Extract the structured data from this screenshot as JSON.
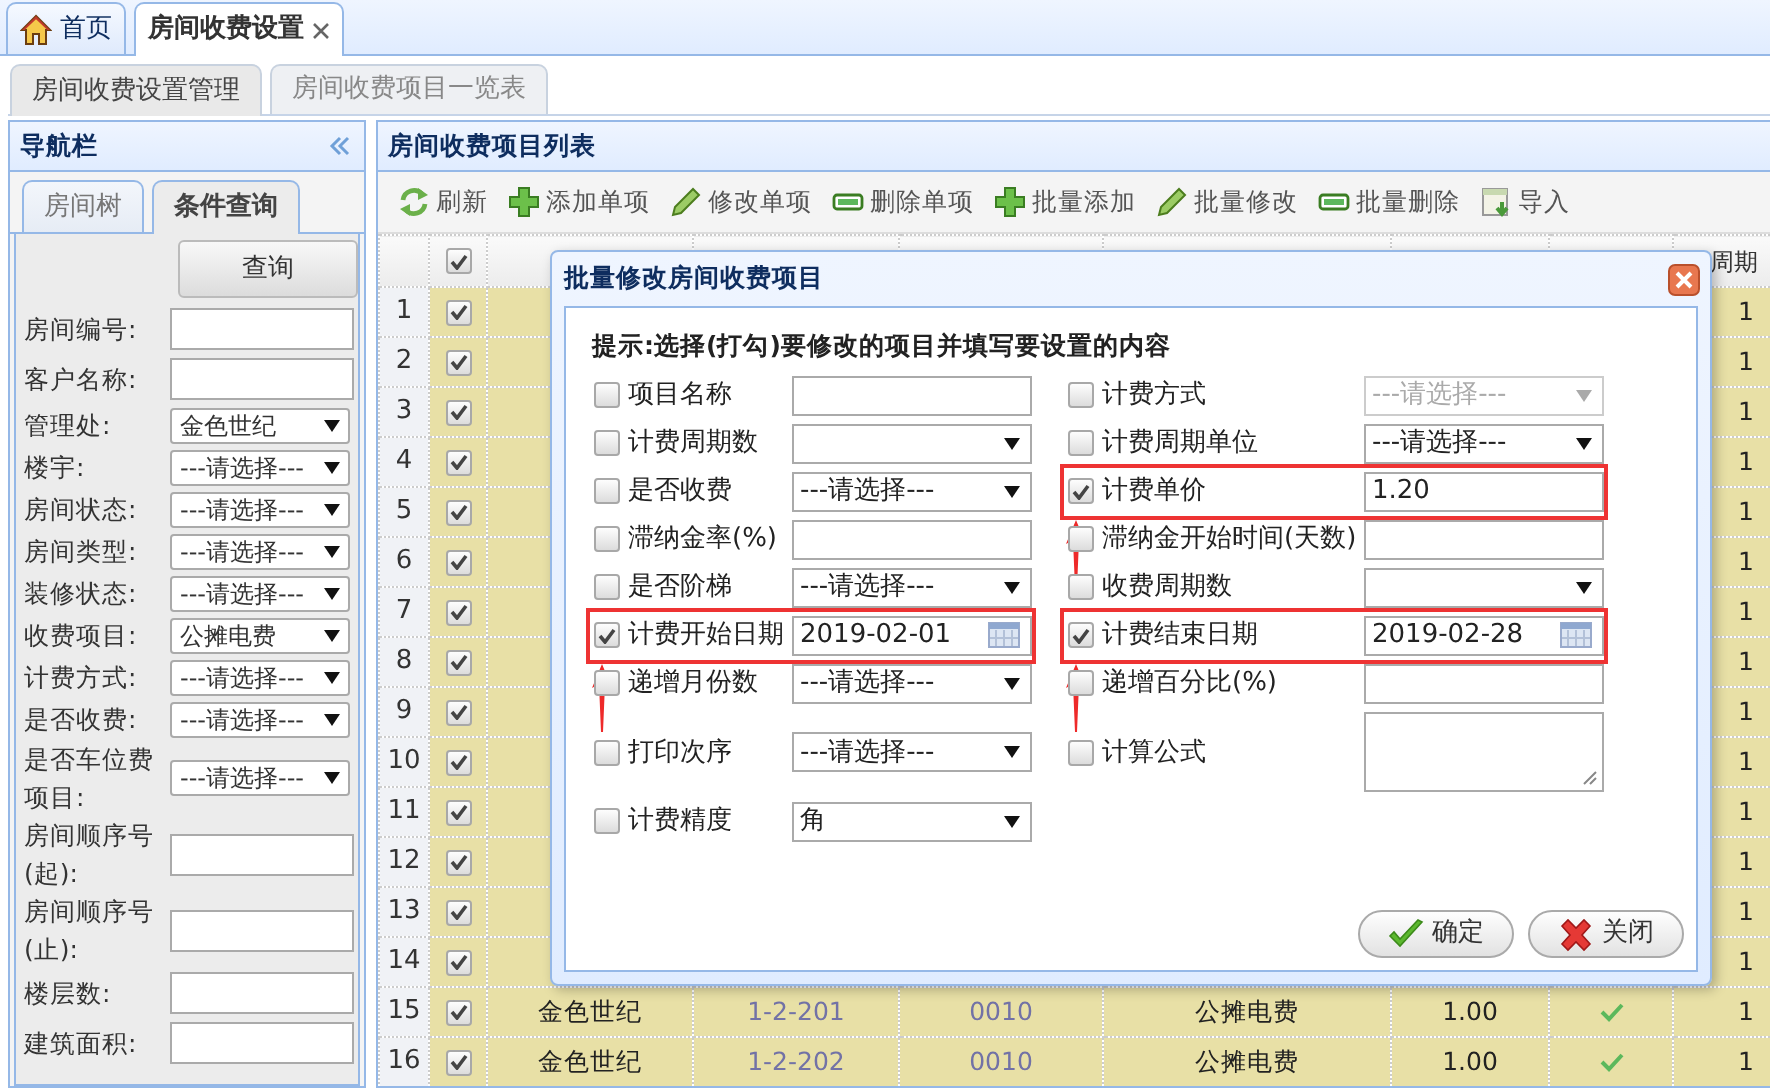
{
  "top_tabs": [
    {
      "label": "首页",
      "kind": "home",
      "selected": false,
      "closable": false
    },
    {
      "label": "房间收费设置",
      "kind": "plain",
      "selected": true,
      "closable": true
    }
  ],
  "sub_tabs": [
    {
      "label": "房间收费设置管理",
      "selected": true
    },
    {
      "label": "房间收费项目一览表",
      "selected": false
    }
  ],
  "sidebar": {
    "title": "导航栏",
    "tabs": [
      {
        "label": "房间树",
        "selected": false
      },
      {
        "label": "条件查询",
        "selected": true
      }
    ],
    "query_button": "查询",
    "fields": [
      {
        "label": "房间编号:",
        "kind": "text"
      },
      {
        "label": "客户名称:",
        "kind": "text"
      },
      {
        "label": "管理处:",
        "kind": "select",
        "value": "金色世纪"
      },
      {
        "label": "楼宇:",
        "kind": "select",
        "value": "---请选择---"
      },
      {
        "label": "房间状态:",
        "kind": "select",
        "value": "---请选择---"
      },
      {
        "label": "房间类型:",
        "kind": "select",
        "value": "---请选择---"
      },
      {
        "label": "装修状态:",
        "kind": "select",
        "value": "---请选择---"
      },
      {
        "label": "收费项目:",
        "kind": "select",
        "value": "公摊电费"
      },
      {
        "label": "计费方式:",
        "kind": "select",
        "value": "---请选择---"
      },
      {
        "label": "是否收费:",
        "kind": "select",
        "value": "---请选择---"
      },
      {
        "label": "是否车位费项目:",
        "kind": "select",
        "value": "---请选择---"
      },
      {
        "label": "房间顺序号(起):",
        "kind": "text"
      },
      {
        "label": "房间顺序号(止):",
        "kind": "text"
      },
      {
        "label": "楼层数:",
        "kind": "text"
      },
      {
        "label": "建筑面积:",
        "kind": "text"
      }
    ]
  },
  "list_panel": {
    "title": "房间收费项目列表",
    "toolbar": [
      {
        "label": "刷新",
        "kind": "refresh"
      },
      {
        "label": "添加单项",
        "kind": "add"
      },
      {
        "label": "修改单项",
        "kind": "edit"
      },
      {
        "label": "删除单项",
        "kind": "remove"
      },
      {
        "label": "批量添加",
        "kind": "add"
      },
      {
        "label": "批量修改",
        "kind": "edit"
      },
      {
        "label": "批量删除",
        "kind": "remove"
      },
      {
        "label": "导入",
        "kind": "import"
      }
    ],
    "table": {
      "all_checked": true,
      "last_column_heading": "周期",
      "rows": [
        {
          "number": "1",
          "checked": true,
          "period": "1"
        },
        {
          "number": "2",
          "checked": true,
          "period": "1"
        },
        {
          "number": "3",
          "checked": true,
          "period": "1"
        },
        {
          "number": "4",
          "checked": true,
          "period": "1"
        },
        {
          "number": "5",
          "checked": true,
          "period": "1"
        },
        {
          "number": "6",
          "checked": true,
          "period": "1"
        },
        {
          "number": "7",
          "checked": true,
          "period": "1"
        },
        {
          "number": "8",
          "checked": true,
          "period": "1"
        },
        {
          "number": "9",
          "checked": true,
          "period": "1"
        },
        {
          "number": "10",
          "checked": true,
          "period": "1"
        },
        {
          "number": "11",
          "checked": true,
          "period": "1"
        },
        {
          "number": "12",
          "checked": true,
          "period": "1"
        },
        {
          "number": "13",
          "checked": true,
          "period": "1"
        },
        {
          "number": "14",
          "checked": true,
          "period": "1"
        },
        {
          "number": "15",
          "checked": true,
          "manager": "金色世纪",
          "room": "1-2-201",
          "code": "0010",
          "item": "公摊电费",
          "amount": "1.00",
          "charged": true,
          "period": "1"
        },
        {
          "number": "16",
          "checked": true,
          "manager": "金色世纪",
          "room": "1-2-202",
          "code": "0010",
          "item": "公摊电费",
          "amount": "1.00",
          "charged": true,
          "period": "1"
        }
      ]
    }
  },
  "dialog": {
    "title": "批量修改房间收费项目",
    "hint": "提示:选择(打勾)要修改的项目并填写要设置的内容",
    "left_fields": [
      {
        "label": "项目名称",
        "kind": "text",
        "checked": false,
        "highlighted": false,
        "disabled": false
      },
      {
        "label": "计费周期数",
        "kind": "select",
        "checked": false,
        "highlighted": false,
        "disabled": false
      },
      {
        "label": "是否收费",
        "kind": "select",
        "value": "---请选择---",
        "checked": false,
        "highlighted": false,
        "disabled": false
      },
      {
        "label": "滞纳金率(%)",
        "kind": "text",
        "checked": false,
        "highlighted": false,
        "disabled": false
      },
      {
        "label": "是否阶梯",
        "kind": "select",
        "value": "---请选择---",
        "checked": false,
        "highlighted": false,
        "disabled": false
      },
      {
        "label": "计费开始日期",
        "kind": "date",
        "value": "2019-02-01",
        "checked": true,
        "highlighted": true,
        "disabled": false
      },
      {
        "label": "递增月份数",
        "kind": "select",
        "value": "---请选择---",
        "checked": false,
        "highlighted": false,
        "disabled": false
      },
      {
        "label": "打印次序",
        "kind": "select",
        "value": "---请选择---",
        "checked": false,
        "highlighted": false,
        "disabled": false
      },
      {
        "label": "计费精度",
        "kind": "select",
        "value": "角",
        "checked": false,
        "highlighted": false,
        "disabled": false
      }
    ],
    "right_fields": [
      {
        "label": "计费方式",
        "kind": "select",
        "value": "---请选择---",
        "checked": false,
        "highlighted": false,
        "disabled": true
      },
      {
        "label": "计费周期单位",
        "kind": "select",
        "value": "---请选择---",
        "checked": false,
        "highlighted": false,
        "disabled": false
      },
      {
        "label": "计费单价",
        "kind": "text",
        "value": "1.20",
        "checked": true,
        "highlighted": true,
        "disabled": false
      },
      {
        "label": "滞纳金开始时间(天数)",
        "kind": "text",
        "checked": false,
        "highlighted": false,
        "disabled": false
      },
      {
        "label": "收费周期数",
        "kind": "select",
        "checked": false,
        "highlighted": false,
        "disabled": false
      },
      {
        "label": "计费结束日期",
        "kind": "date",
        "value": "2019-02-28",
        "checked": true,
        "highlighted": true,
        "disabled": false
      },
      {
        "label": "递增百分比(%)",
        "kind": "text",
        "checked": false,
        "highlighted": false,
        "disabled": false
      },
      {
        "label": "计算公式",
        "kind": "textarea",
        "checked": false,
        "highlighted": false,
        "disabled": false
      }
    ],
    "buttons": [
      {
        "label": "确定",
        "kind": "ok"
      },
      {
        "label": "关闭",
        "kind": "close"
      }
    ]
  }
}
